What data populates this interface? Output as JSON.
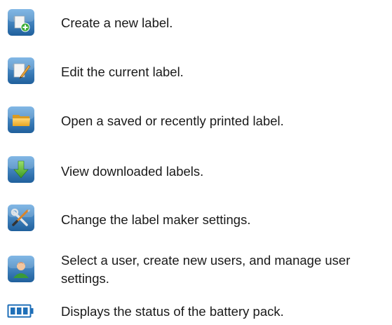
{
  "items": [
    {
      "icon": "new-label-icon",
      "text": "Create a new label."
    },
    {
      "icon": "edit-label-icon",
      "text": "Edit the current label."
    },
    {
      "icon": "folder-icon",
      "text": "Open a saved or recently printed label."
    },
    {
      "icon": "download-arrow-icon",
      "text": "View downloaded labels."
    },
    {
      "icon": "tools-icon",
      "text": "Change the label maker settings."
    },
    {
      "icon": "user-icon",
      "text": "Select a user, create new users, and manage user settings."
    },
    {
      "icon": "battery-icon",
      "text": "Displays the status of the battery pack."
    }
  ],
  "colors": {
    "icon_blue_top": "#5b9fd8",
    "icon_blue_bottom": "#1f5f9c",
    "battery_blue": "#1f6fb8",
    "text": "#1a1a1a"
  }
}
